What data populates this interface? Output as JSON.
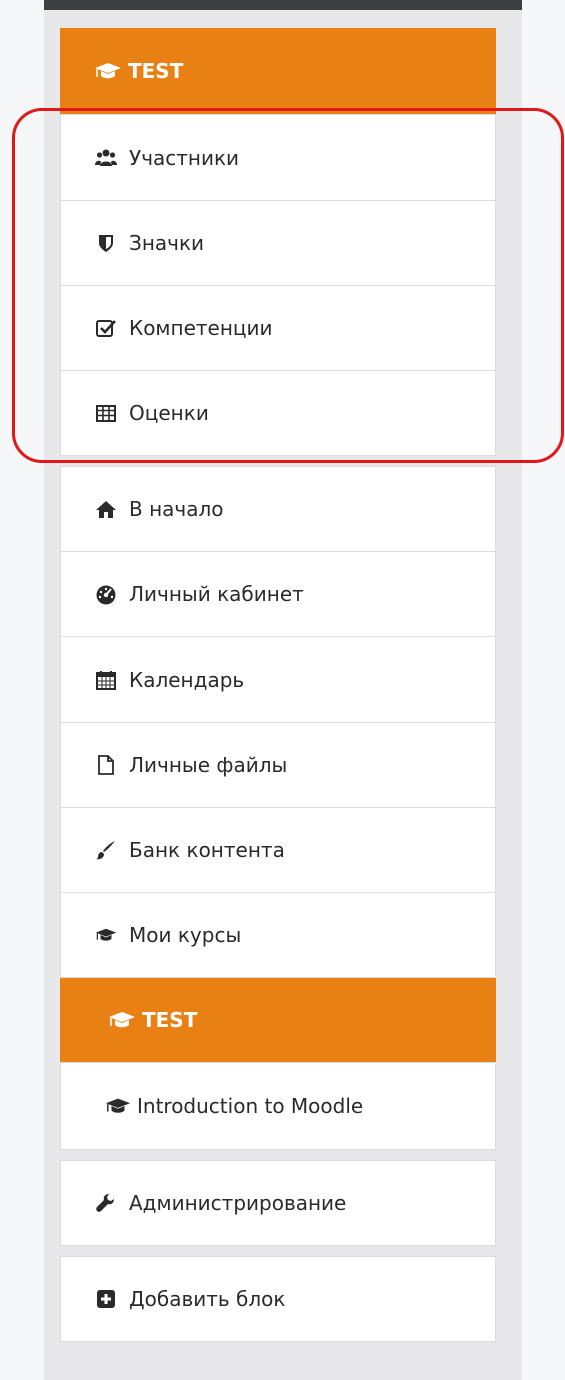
{
  "course_section": {
    "header": "TEST",
    "items": [
      {
        "label": "Участники",
        "icon": "users-icon"
      },
      {
        "label": "Значки",
        "icon": "shield-icon"
      },
      {
        "label": "Компетенции",
        "icon": "checkbox-icon"
      },
      {
        "label": "Оценки",
        "icon": "table-icon"
      }
    ]
  },
  "nav_section": {
    "items": [
      {
        "label": "В начало",
        "icon": "home-icon"
      },
      {
        "label": "Личный кабинет",
        "icon": "dashboard-icon"
      },
      {
        "label": "Календарь",
        "icon": "calendar-icon"
      },
      {
        "label": "Личные файлы",
        "icon": "file-icon"
      },
      {
        "label": "Банк контента",
        "icon": "paint-brush-icon"
      },
      {
        "label": "Мои курсы",
        "icon": "graduation-cap-icon"
      }
    ]
  },
  "my_courses": {
    "header": "TEST",
    "items": [
      {
        "label": "Introduction to Moodle",
        "icon": "graduation-cap-icon"
      }
    ]
  },
  "admin": {
    "label": "Администрирование",
    "icon": "wrench-icon"
  },
  "add_block": {
    "label": "Добавить блок",
    "icon": "plus-square-icon"
  },
  "colors": {
    "accent": "#e98014",
    "highlight": "#e01818"
  }
}
